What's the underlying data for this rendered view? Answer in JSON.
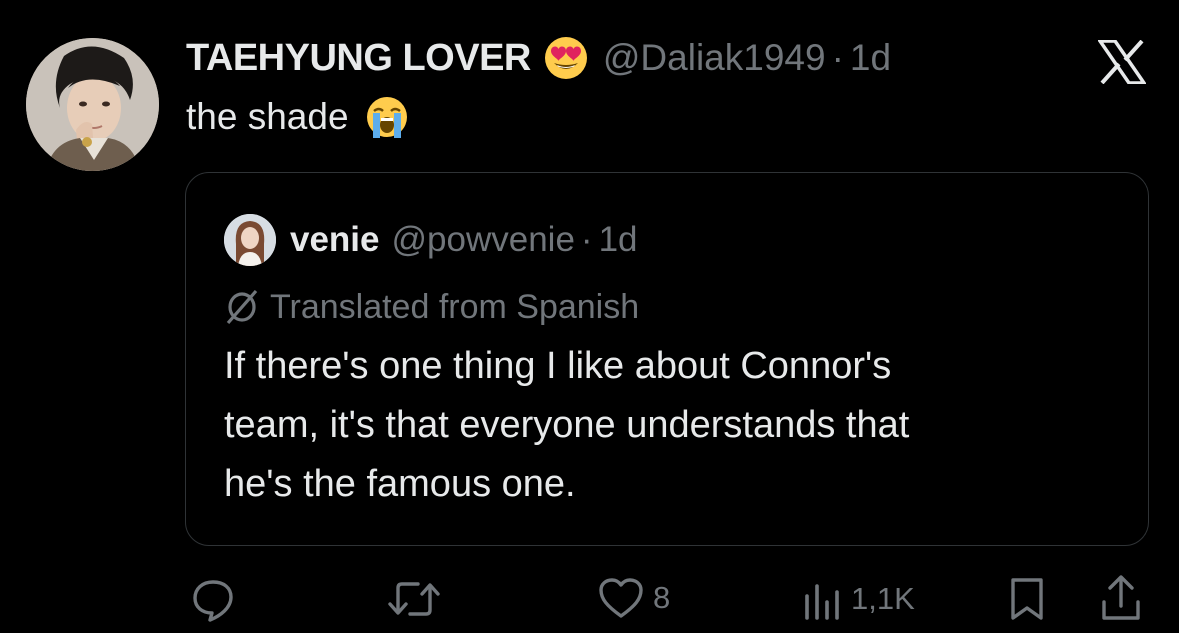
{
  "tweet": {
    "display_name": "TAEHYUNG LOVER",
    "name_emoji": "heart-eyes-emoji",
    "handle": "@Daliak1949",
    "separator": "·",
    "time": "1d",
    "text": "the shade",
    "text_emoji": "loudly-crying-emoji"
  },
  "quoted": {
    "display_name": "venie",
    "handle": "@powvenie",
    "separator": "·",
    "time": "1d",
    "translated_label": "Translated from Spanish",
    "text_lines": [
      "If there's one thing I like about Connor's",
      "team, it's that everyone understands that",
      "he's the famous one."
    ]
  },
  "actions": {
    "reply_icon": "reply-icon",
    "retweet_icon": "retweet-icon",
    "like_icon": "heart-icon",
    "like_count": "8",
    "views_icon": "views-icon",
    "views_count": "1,1K",
    "bookmark_icon": "bookmark-icon",
    "share_icon": "share-icon"
  },
  "brand": {
    "logo": "x-logo-icon"
  },
  "colors": {
    "background": "#000000",
    "text_primary": "#e7e9ea",
    "text_secondary": "#71767b",
    "border": "#2f3336"
  }
}
